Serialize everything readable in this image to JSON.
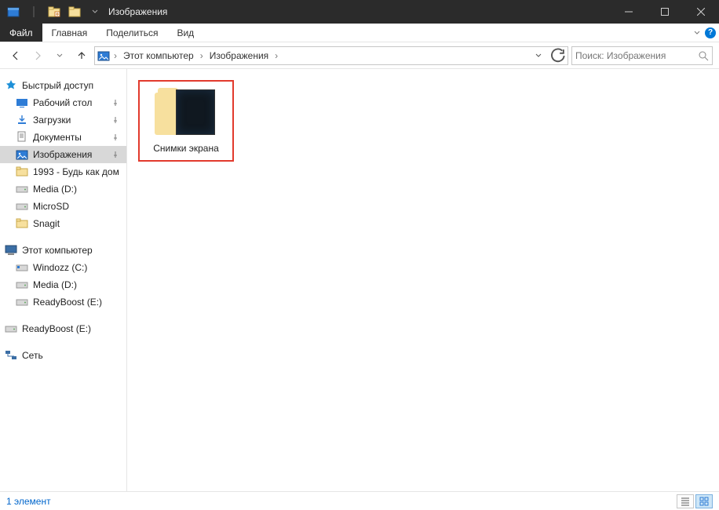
{
  "window": {
    "title": "Изображения"
  },
  "ribbon": {
    "file": "Файл",
    "tabs": [
      "Главная",
      "Поделиться",
      "Вид"
    ]
  },
  "breadcrumb": {
    "items": [
      "Этот компьютер",
      "Изображения"
    ]
  },
  "search": {
    "placeholder": "Поиск: Изображения"
  },
  "tree": {
    "quick_access": {
      "label": "Быстрый доступ",
      "items": [
        {
          "label": "Рабочий стол",
          "icon": "desktop",
          "pinned": true
        },
        {
          "label": "Загрузки",
          "icon": "downloads",
          "pinned": true
        },
        {
          "label": "Документы",
          "icon": "documents",
          "pinned": true
        },
        {
          "label": "Изображения",
          "icon": "pictures",
          "pinned": true,
          "selected": true
        },
        {
          "label": "1993 - Будь как дом",
          "icon": "folder",
          "pinned": false
        },
        {
          "label": "Media (D:)",
          "icon": "drive",
          "pinned": false
        },
        {
          "label": "MicroSD",
          "icon": "drive",
          "pinned": false
        },
        {
          "label": "Snagit",
          "icon": "folder",
          "pinned": false
        }
      ]
    },
    "this_pc": {
      "label": "Этот компьютер",
      "items": [
        {
          "label": "Windozz (C:)",
          "icon": "drive-os"
        },
        {
          "label": "Media (D:)",
          "icon": "drive"
        },
        {
          "label": "ReadyBoost (E:)",
          "icon": "drive"
        }
      ]
    },
    "extra": {
      "label": "ReadyBoost (E:)"
    },
    "network": {
      "label": "Сеть"
    }
  },
  "content": {
    "items": [
      {
        "label": "Снимки экрана"
      }
    ]
  },
  "statusbar": {
    "count": "1 элемент"
  }
}
